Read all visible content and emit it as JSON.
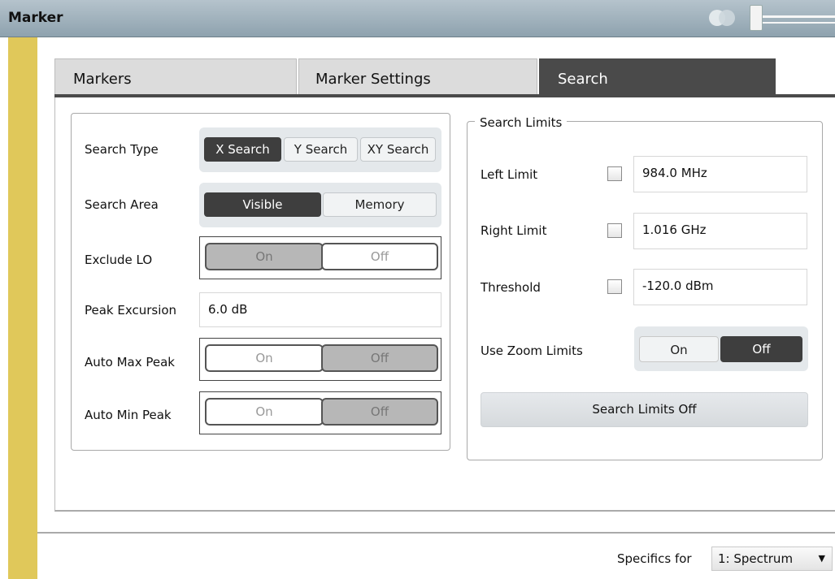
{
  "window": {
    "title": "Marker"
  },
  "tabs": [
    {
      "label": "Markers"
    },
    {
      "label": "Marker Settings"
    },
    {
      "label": "Search"
    }
  ],
  "left_group": {
    "search_type": {
      "label": "Search Type",
      "options": [
        "X Search",
        "Y Search",
        "XY Search"
      ],
      "selected": "X Search"
    },
    "search_area": {
      "label": "Search Area",
      "options": [
        "Visible",
        "Memory"
      ],
      "selected": "Visible"
    },
    "exclude_lo": {
      "label": "Exclude LO",
      "on": "On",
      "off": "Off",
      "selected": "On"
    },
    "peak_excursion": {
      "label": "Peak Excursion",
      "value": "6.0 dB"
    },
    "auto_max_peak": {
      "label": "Auto Max Peak",
      "on": "On",
      "off": "Off",
      "selected": "Off"
    },
    "auto_min_peak": {
      "label": "Auto Min Peak",
      "on": "On",
      "off": "Off",
      "selected": "Off"
    }
  },
  "search_limits": {
    "legend": "Search Limits",
    "left_limit": {
      "label": "Left Limit",
      "value": "984.0 MHz",
      "checked": false
    },
    "right_limit": {
      "label": "Right Limit",
      "value": "1.016 GHz",
      "checked": false
    },
    "threshold": {
      "label": "Threshold",
      "value": "-120.0 dBm",
      "checked": false
    },
    "use_zoom_limits": {
      "label": "Use Zoom Limits",
      "on": "On",
      "off": "Off",
      "selected": "Off"
    },
    "off_button": "Search Limits Off"
  },
  "footer": {
    "specifics_label": "Specifics for",
    "specifics_value": "1: Spectrum",
    "arrow": "▼"
  },
  "colors": {
    "title_bar": "#9fb1bc",
    "left_stripe": "#e0c85a",
    "selected_dark": "#3e3e3e"
  }
}
